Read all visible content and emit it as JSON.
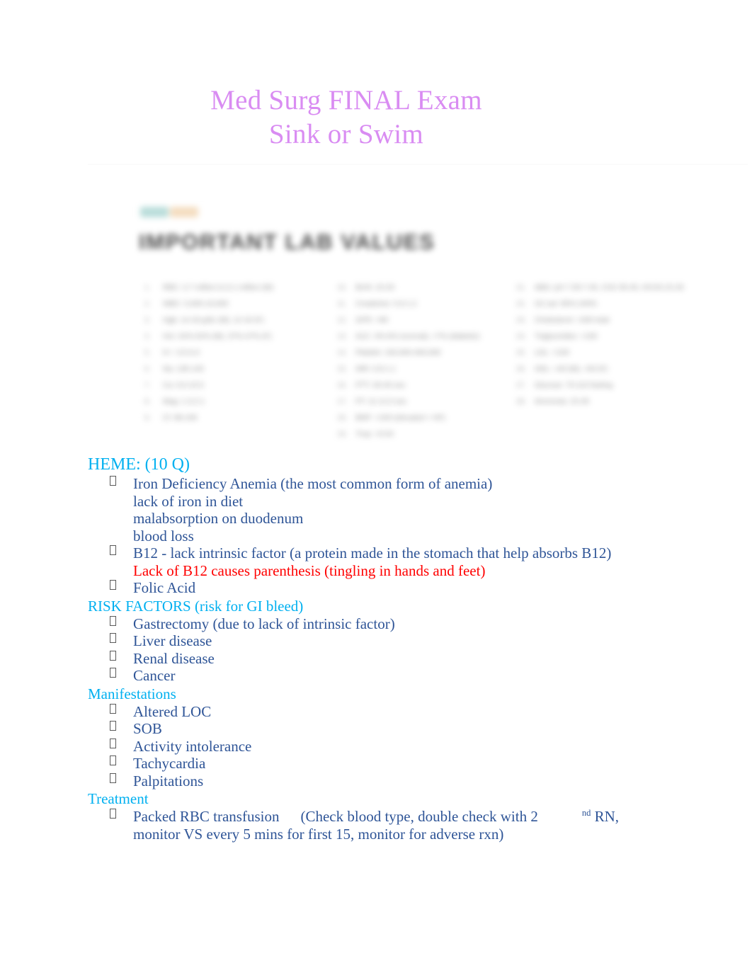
{
  "document": {
    "title_lines": [
      "Med Surg FINAL Exam",
      "Sink or Swim"
    ],
    "title_color": "#D98CF2",
    "heading_color": "#00B0F0",
    "body_color": "#2F5597",
    "alert_color": "#FF0000"
  },
  "figure": {
    "name": "important-lab-values-image",
    "heading": "IMPORTANT LAB VALUES",
    "tags": [
      {
        "name": "tag-teal",
        "color": "#b9ddda"
      },
      {
        "name": "tag-peach",
        "color": "#f4ddc0"
      }
    ],
    "columns": [
      {
        "items": [
          {
            "num": "1.",
            "text": "RBC: 4.7 million to 6.1 million (M)"
          },
          {
            "num": "2.",
            "text": "WBC: 5,000-10,000"
          },
          {
            "num": "3.",
            "text": "Hgb: 14-18 g/dL (M), 12-16 (F)"
          },
          {
            "num": "4.",
            "text": "Hct: 42%-52% (M), 37%-47% (F)"
          },
          {
            "num": "5.",
            "text": "K+: 3.5-5.0"
          },
          {
            "num": "6.",
            "text": "Na: 135-145"
          },
          {
            "num": "7.",
            "text": "Ca: 9.0-10.5"
          },
          {
            "num": "8.",
            "text": "Mag: 1.3-2.1"
          },
          {
            "num": "9.",
            "text": "Cl: 98-106"
          }
        ]
      },
      {
        "items": [
          {
            "num": "10.",
            "text": "BUN: 10-20"
          },
          {
            "num": "11.",
            "text": "Creatinine: 0.6-1.2"
          },
          {
            "num": "12.",
            "text": "GFR: >90"
          },
          {
            "num": "13.",
            "text": "A1C: 4%-6% (normal), <7% (diabetic)"
          },
          {
            "num": "14.",
            "text": "Platelet: 150,000-400,000"
          },
          {
            "num": "15.",
            "text": "INR: 0.8-1.1"
          },
          {
            "num": "16.",
            "text": "PTT: 30-40 sec"
          },
          {
            "num": "17.",
            "text": "PT: 11-12.5 sec"
          },
          {
            "num": "18.",
            "text": "BNP: <100 (elevated = HF)"
          },
          {
            "num": "19.",
            "text": "Trop: <0.04"
          },
          {
            "num": "20.",
            "text": "Albumin: 3.5-5.0"
          }
        ]
      },
      {
        "items": [
          {
            "num": "21.",
            "text": "ABG: pH 7.35-7.45, CO2 35-45, HCO3 22-26"
          },
          {
            "num": "22.",
            "text": "O2 sat: 95%-100%"
          },
          {
            "num": "23.",
            "text": "Cholesterol: <200 total"
          },
          {
            "num": "24.",
            "text": "Triglycerides: <150"
          },
          {
            "num": "25.",
            "text": "LDL: <100"
          },
          {
            "num": "26.",
            "text": "HDL: >40 (M), >50 (F)"
          },
          {
            "num": "27.",
            "text": "Glucose: 70-110 fasting"
          },
          {
            "num": "28.",
            "text": "Ammonia: 15-45"
          }
        ]
      }
    ]
  },
  "sections": [
    {
      "id": "heme",
      "heading": "HEME: (10 Q)",
      "heading_size": "large",
      "items": [
        {
          "type": "bullet",
          "text": "Iron Deficiency Anemia (the most common form of anemia)",
          "sub_lines": [
            "lack of iron in diet",
            "malabsorption on duodenum",
            "blood loss"
          ]
        },
        {
          "type": "bullet",
          "text": "B12 - lack intrinsic factor (a protein made in the stomach that help absorbs B12)",
          "alert_lines": [
            "Lack of B12 causes parenthesis (tingling in hands and feet)"
          ]
        },
        {
          "type": "bullet",
          "text": "Folic Acid"
        }
      ]
    },
    {
      "id": "risk-factors",
      "heading": "RISK FACTORS (risk for GI bleed)",
      "heading_size": "small",
      "items": [
        {
          "type": "bullet",
          "text": "Gastrectomy (due to lack of intrinsic factor)"
        },
        {
          "type": "bullet",
          "text": "Liver disease"
        },
        {
          "type": "bullet",
          "text": "Renal disease"
        },
        {
          "type": "bullet",
          "text": "Cancer"
        }
      ]
    },
    {
      "id": "manifestations",
      "heading": "Manifestations",
      "heading_size": "small",
      "items": [
        {
          "type": "bullet",
          "text": "Altered LOC"
        },
        {
          "type": "bullet",
          "text": "SOB"
        },
        {
          "type": "bullet",
          "text": "Activity intolerance"
        },
        {
          "type": "bullet",
          "text": "Tachycardia"
        },
        {
          "type": "bullet",
          "text": "Palpitations"
        }
      ]
    },
    {
      "id": "treatment",
      "heading": "Treatment",
      "heading_size": "small",
      "items": [
        {
          "type": "bullet-treatment",
          "part1": "Packed RBC transfusion",
          "part2": "(Check blood type, double check with 2",
          "superscript": "nd",
          "part3": "RN,",
          "wrap": "monitor VS every 5 mins for first 15, monitor for adverse rxn)"
        }
      ]
    }
  ]
}
